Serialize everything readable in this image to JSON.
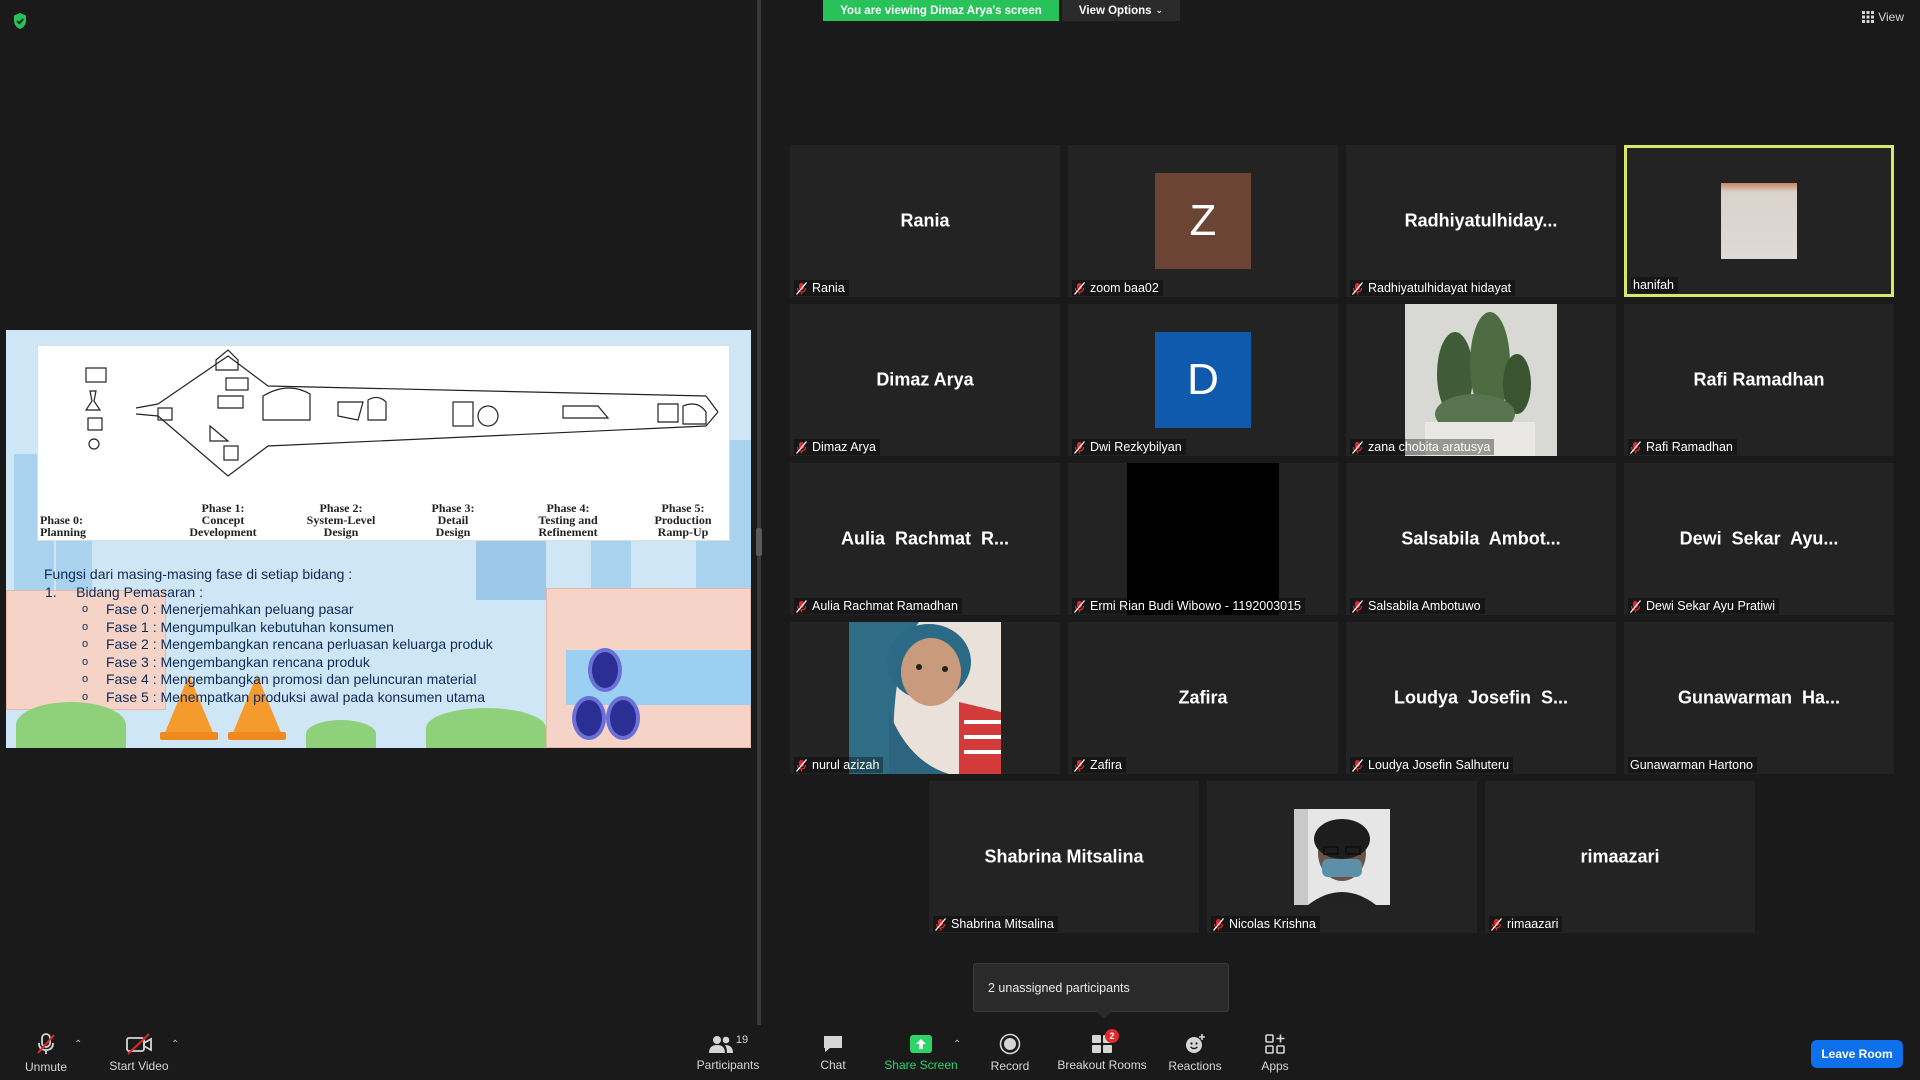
{
  "banner": {
    "viewing_text": "You are viewing Dimaz Arya's screen",
    "view_options_label": "View Options",
    "view_label": "View"
  },
  "slide": {
    "phases": [
      {
        "line1": "Phase 0:",
        "line2": "Planning"
      },
      {
        "line1": "Phase 1:",
        "line2": "Concept",
        "line3": "Development"
      },
      {
        "line1": "Phase 2:",
        "line2": "System-Level",
        "line3": "Design"
      },
      {
        "line1": "Phase 3:",
        "line2": "Detail",
        "line3": "Design"
      },
      {
        "line1": "Phase 4:",
        "line2": "Testing and",
        "line3": "Refinement"
      },
      {
        "line1": "Phase 5:",
        "line2": "Production",
        "line3": "Ramp-Up"
      }
    ],
    "intro": "Fungsi dari masing-masing fase di setiap bidang :",
    "section": "1.     Bidang Pemasaran :",
    "bullet_symbol": "o",
    "items": [
      "Fase 0 : Menerjemahkan peluang pasar",
      "Fase 1 : Mengumpulkan kebutuhan konsumen",
      "Fase 2 : Mengembangkan rencana perluasan keluarga produk",
      "Fase 3 : Mengembangkan rencana produk",
      "Fase 4 : Mengembangkan promosi dan peluncuran material",
      "Fase 5 : Menempatkan produksi awal pada konsumen utama"
    ]
  },
  "participants": [
    {
      "center": "Rania",
      "label": "Rania",
      "muted": true
    },
    {
      "avatar": "Z",
      "avatar_color": "#6b4436",
      "label": "zoom baa02",
      "muted": true
    },
    {
      "center": "Radhiyatulhiday...",
      "label": "Radhiyatulhidayat hidayat",
      "muted": true
    },
    {
      "video": "hanifah-video",
      "label": "hanifah",
      "muted": false,
      "active": true
    },
    {
      "center": "Dimaz Arya",
      "label": "Dimaz Arya",
      "muted": true
    },
    {
      "avatar": "D",
      "avatar_color": "#0f5aad",
      "label": "Dwi Rezkybilyan",
      "muted": true
    },
    {
      "video": "cactus-video",
      "label": "zana chobita aratusya",
      "muted": true
    },
    {
      "center": "Rafi Ramadhan",
      "label": "Rafi Ramadhan",
      "muted": true
    },
    {
      "center": "Aulia  Rachmat  R...",
      "label": "Aulia Rachmat Ramadhan",
      "muted": true
    },
    {
      "video": "black-video",
      "label": "Ermi Rian Budi Wibowo - 1192003015",
      "muted": true
    },
    {
      "center": "Salsabila  Ambot...",
      "label": "Salsabila Ambotuwo",
      "muted": true
    },
    {
      "center": "Dewi  Sekar  Ayu...",
      "label": "Dewi Sekar Ayu Pratiwi",
      "muted": true
    },
    {
      "video": "nurul-video",
      "label": "nurul azizah",
      "muted": true
    },
    {
      "center": "Zafira",
      "label": "Zafira",
      "muted": true
    },
    {
      "center": "Loudya  Josefin  S...",
      "label": "Loudya Josefin Salhuteru",
      "muted": true
    },
    {
      "center": "Gunawarman  Ha...",
      "label": "Gunawarman Hartono",
      "muted": false
    },
    {
      "center": "Shabrina Mitsalina",
      "label": "Shabrina Mitsalina",
      "muted": true
    },
    {
      "video": "nicolas-video",
      "label": "Nicolas Krishna",
      "muted": true
    },
    {
      "center": "rimaazari",
      "label": "rimaazari",
      "muted": true
    }
  ],
  "popup": {
    "text": "2 unassigned participants"
  },
  "toolbar": {
    "unmute": "Unmute",
    "start_video": "Start Video",
    "participants": "Participants",
    "participants_count": "19",
    "chat": "Chat",
    "share_screen": "Share Screen",
    "record": "Record",
    "breakout_rooms": "Breakout Rooms",
    "breakout_badge": "2",
    "reactions": "Reactions",
    "apps": "Apps",
    "leave_room": "Leave Room"
  },
  "colors": {
    "share_green": "#2ed46a",
    "banner_green": "#27c25a",
    "leave_blue": "#0e71eb",
    "active_border": "#d8e86a",
    "muted_red": "#e02828"
  }
}
